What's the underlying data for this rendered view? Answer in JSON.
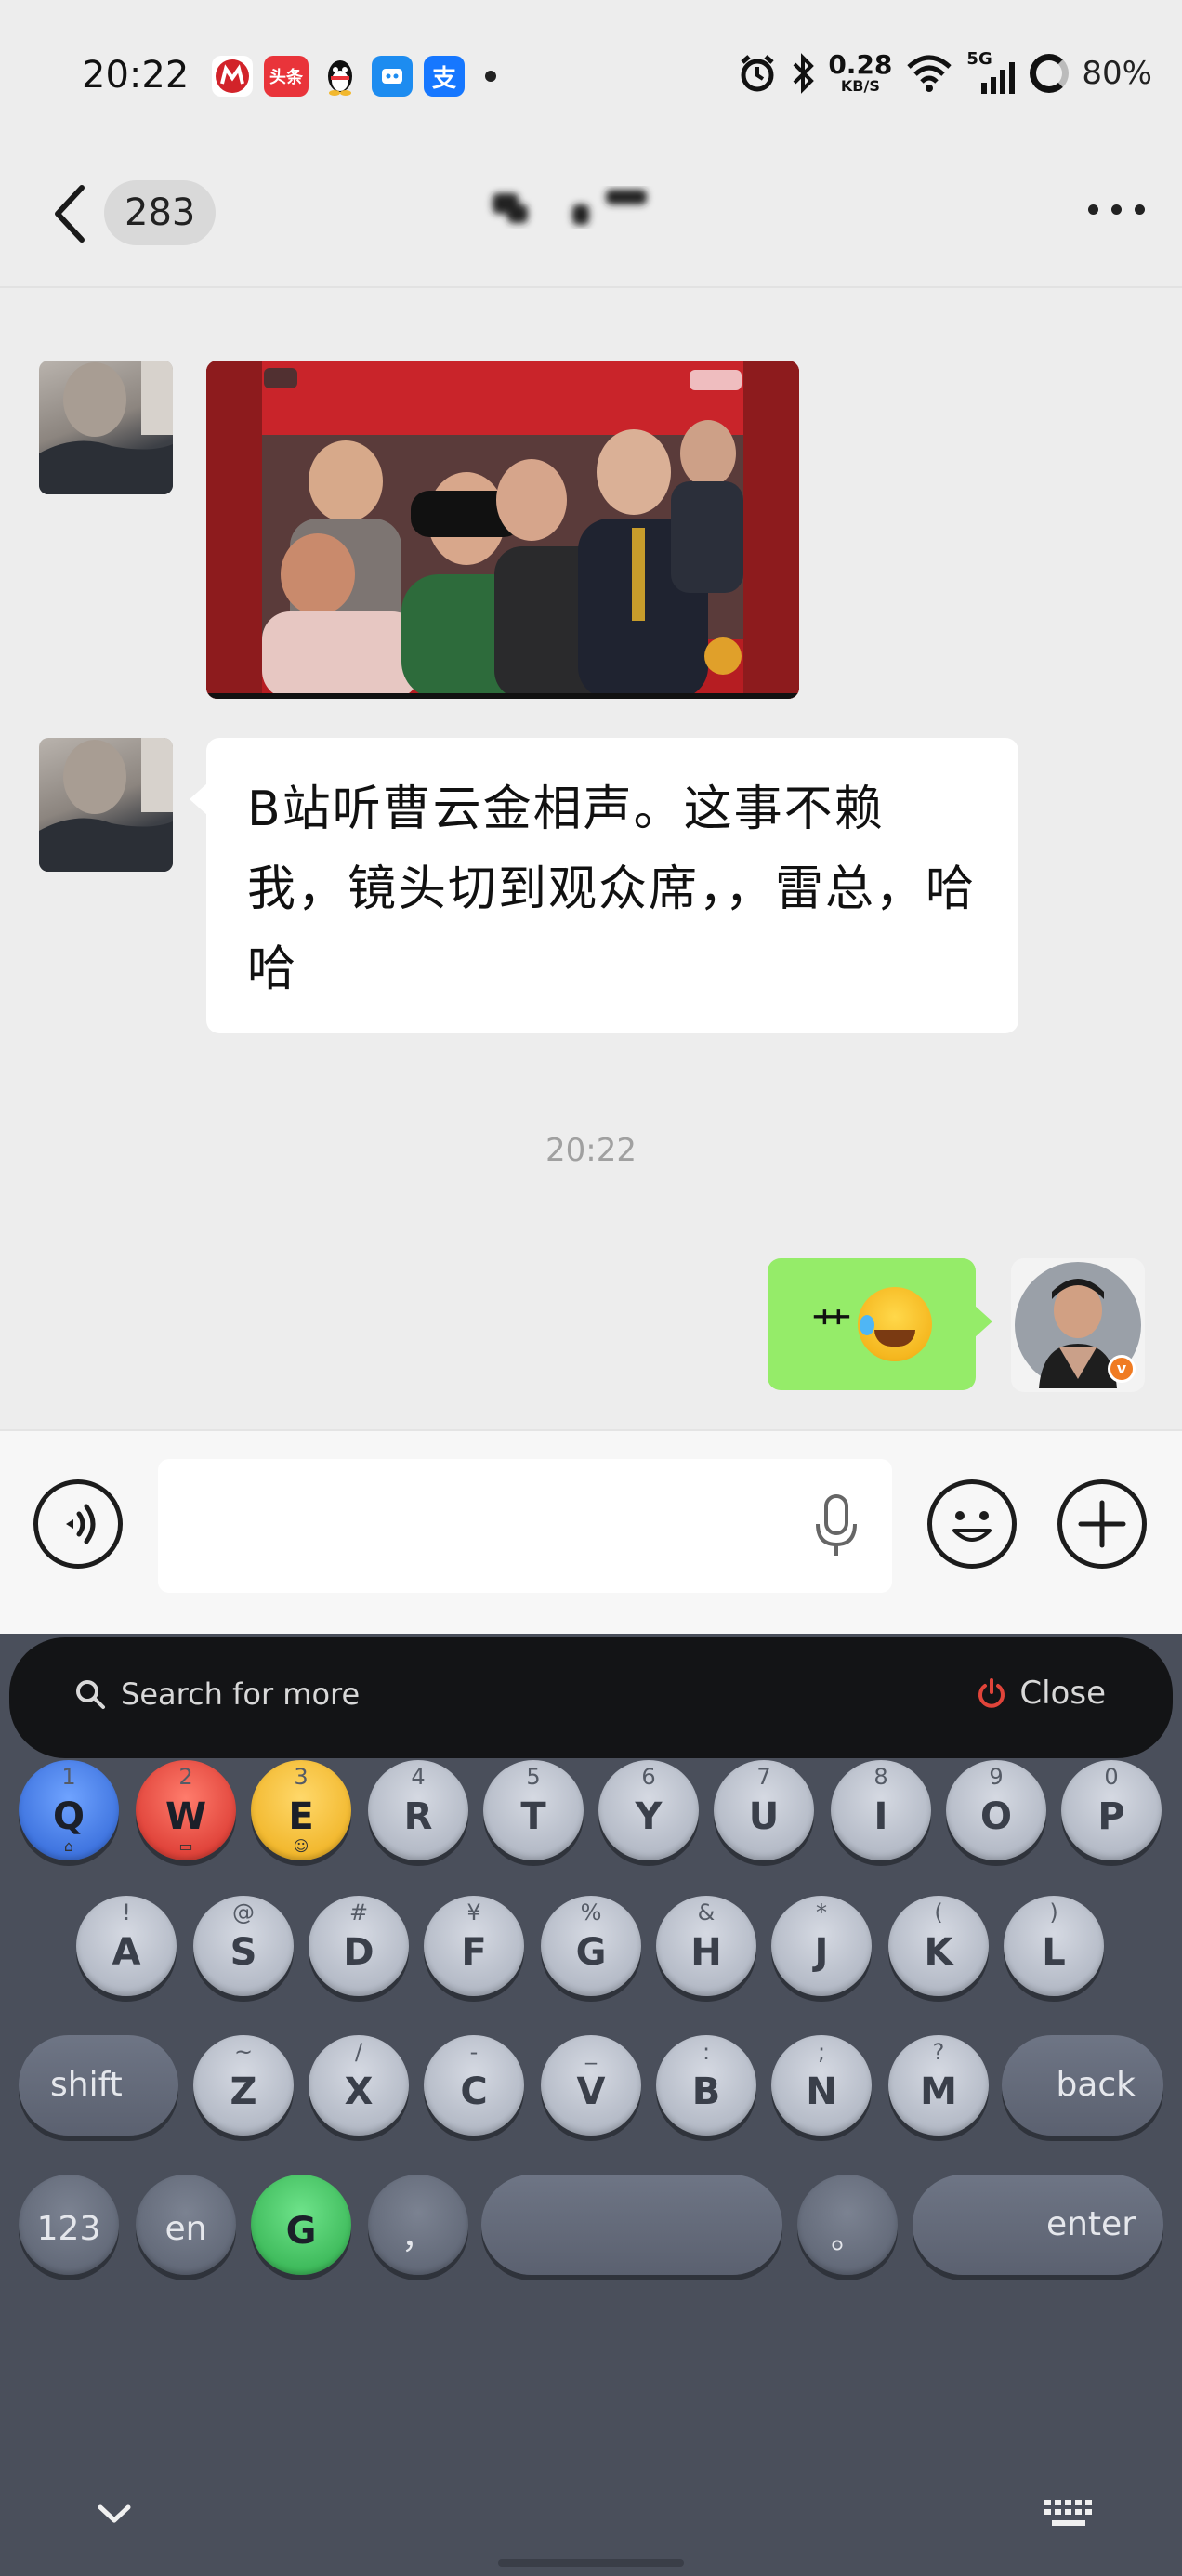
{
  "status_bar": {
    "time": "20:22",
    "net_speed_value": "0.28",
    "net_speed_unit": "KB/S",
    "network": "5G",
    "battery": "80%",
    "app_icons": [
      "metro-app-icon",
      "toutiao-icon",
      "qq-icon",
      "qq-browser-icon",
      "alipay-icon"
    ],
    "toutiao_label": "头条",
    "alipay_label": "支"
  },
  "nav": {
    "unread_count": "283"
  },
  "messages": {
    "received_text": "B站听曹云金相声。这事不赖我，镜头切到观众席，，雷总，哈哈",
    "timestamp": "20:22",
    "sent_text": "艹"
  },
  "keyboard": {
    "search_placeholder": "Search for more",
    "close_label": "Close",
    "row1": [
      {
        "sub": "1",
        "main": "Q"
      },
      {
        "sub": "2",
        "main": "W"
      },
      {
        "sub": "3",
        "main": "E"
      },
      {
        "sub": "4",
        "main": "R"
      },
      {
        "sub": "5",
        "main": "T"
      },
      {
        "sub": "6",
        "main": "Y"
      },
      {
        "sub": "7",
        "main": "U"
      },
      {
        "sub": "8",
        "main": "I"
      },
      {
        "sub": "9",
        "main": "O"
      },
      {
        "sub": "0",
        "main": "P"
      }
    ],
    "row2": [
      {
        "sub": "!",
        "main": "A"
      },
      {
        "sub": "@",
        "main": "S"
      },
      {
        "sub": "#",
        "main": "D"
      },
      {
        "sub": "¥",
        "main": "F"
      },
      {
        "sub": "%",
        "main": "G"
      },
      {
        "sub": "&",
        "main": "H"
      },
      {
        "sub": "*",
        "main": "J"
      },
      {
        "sub": "(",
        "main": "K"
      },
      {
        "sub": ")",
        "main": "L"
      }
    ],
    "row3": [
      {
        "sub": "~",
        "main": "Z"
      },
      {
        "sub": "/",
        "main": "X"
      },
      {
        "sub": "-",
        "main": "C"
      },
      {
        "sub": "_",
        "main": "V"
      },
      {
        "sub": ":",
        "main": "B"
      },
      {
        "sub": ";",
        "main": "N"
      },
      {
        "sub": "?",
        "main": "M"
      }
    ],
    "shift_label": "shift",
    "back_label": "back",
    "num_label": "123",
    "lang_label": "en",
    "g_label": "G",
    "comma_label": "，",
    "period_label": "。",
    "enter_label": "enter"
  },
  "colors": {
    "sent_bubble": "#95ec69",
    "chat_bg": "#ededed",
    "keyboard_bg": "#4a4f5b"
  }
}
